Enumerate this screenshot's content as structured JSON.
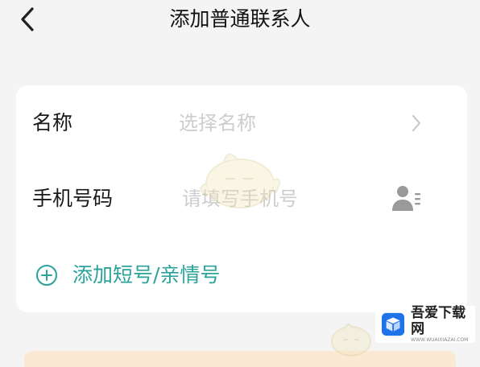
{
  "header": {
    "back_icon": "chevron-left-icon",
    "title": "添加普通联系人"
  },
  "form": {
    "name_row": {
      "label": "名称",
      "placeholder": "选择名称",
      "action_icon": "chevron-right-icon"
    },
    "phone_row": {
      "label": "手机号码",
      "placeholder": "请填写手机号",
      "action_icon": "contact-picker-icon"
    },
    "add_link": {
      "icon": "plus-circle-icon",
      "label": "添加短号/亲情号"
    }
  },
  "watermark": {
    "title": "吾爱下载网",
    "subtitle": "WWW.WUAIXIAZAI.COM"
  },
  "colors": {
    "accent": "#2aa39a",
    "background": "#f4f4f4",
    "placeholder": "#cdcdcd"
  }
}
